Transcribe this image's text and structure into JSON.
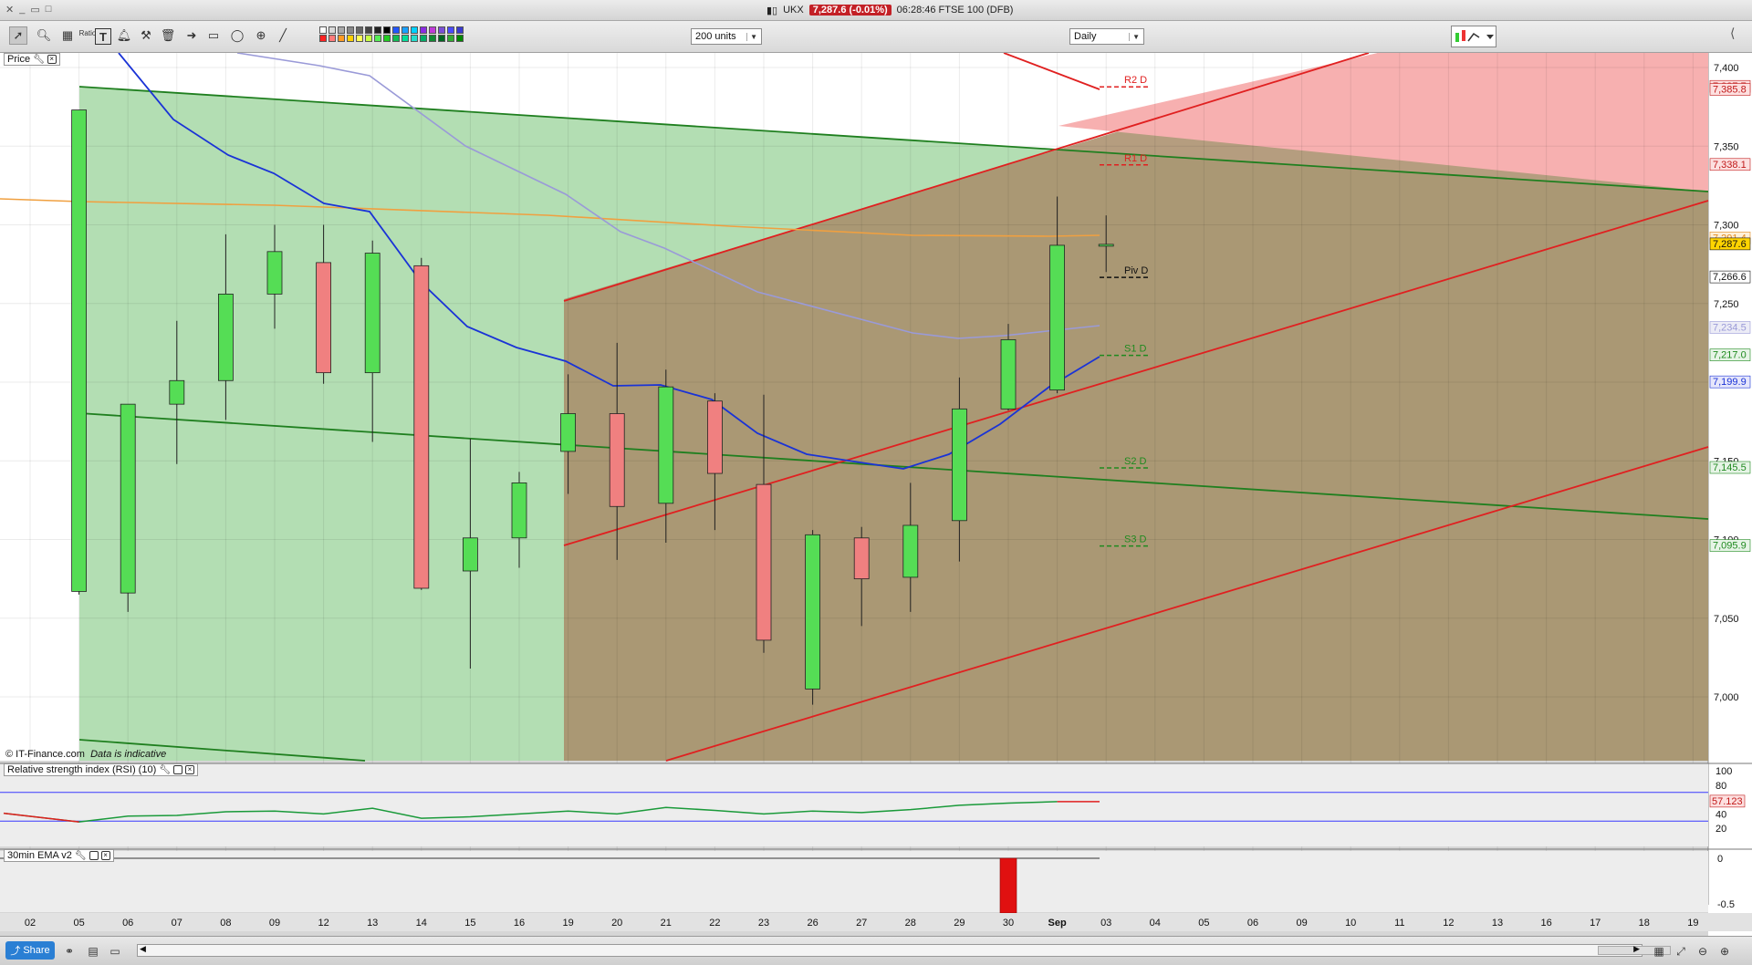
{
  "window": {
    "symbol": "UKX",
    "price_badge": "7,287.6 (-0.01%)",
    "subtitle": "06:28:46 FTSE 100 (DFB)"
  },
  "toolbar": {
    "units_select": "200 units",
    "interval_select": "Daily",
    "tools": [
      "pointer-icon",
      "zoom-icon",
      "ratio-icon",
      "text-icon",
      "alert-icon",
      "hammer-icon",
      "trash-icon",
      "arrow-icon",
      "rectangle-icon",
      "ellipse-icon",
      "crosshair-icon",
      "line-icon"
    ],
    "ratio_label": "Ratio",
    "text_tool_label": "T",
    "swatch_colors": [
      "#ffffff",
      "#d8d8d8",
      "#a8a8a8",
      "#888888",
      "#666666",
      "#444444",
      "#222222",
      "#000000",
      "#2255ff",
      "#1aa0ff",
      "#00d0ff",
      "#8a2be2",
      "#c03ad8",
      "#7a4fd6",
      "#4b4bff",
      "#3a3acf",
      "#ff2222",
      "#ff7a7a",
      "#ff9a22",
      "#ffd000",
      "#ffff55",
      "#c8ff44",
      "#55ee55",
      "#22cc22",
      "#11bb55",
      "#00dd99",
      "#22ddcc",
      "#00aa66",
      "#118833",
      "#006622",
      "#33aa33",
      "#008800"
    ]
  },
  "panels": {
    "price_label": "Price",
    "rsi_label": "Relative strength index (RSI) (10)",
    "ema_label": "30min EMA v2",
    "watermark": "© IT-Finance.com",
    "watermark_note": "Data is indicative"
  },
  "bottom": {
    "share_label": "Share"
  },
  "chart_data": {
    "type": "candlestick",
    "title": "",
    "x_labels": [
      "02",
      "05",
      "06",
      "07",
      "08",
      "09",
      "12",
      "13",
      "14",
      "15",
      "16",
      "19",
      "20",
      "21",
      "22",
      "23",
      "26",
      "27",
      "28",
      "29",
      "30",
      "Sep",
      "03",
      "04",
      "05",
      "06",
      "09",
      "10",
      "11",
      "12",
      "13",
      "16",
      "17",
      "18",
      "19"
    ],
    "y_ticks": [
      "7,400",
      "7,350",
      "7,300",
      "7,250",
      "7,200",
      "7,150",
      "7,100",
      "7,050",
      "7,000"
    ],
    "y_range": [
      6975,
      7420
    ],
    "candles": [
      {
        "x": "05",
        "o": 7067,
        "h": 7070,
        "l": 7065,
        "c": 7373
      },
      {
        "x": "06",
        "o": 7066,
        "h": 7134,
        "l": 7054,
        "c": 7186
      },
      {
        "x": "07",
        "o": 7186,
        "h": 7239,
        "l": 7148,
        "c": 7201
      },
      {
        "x": "08",
        "o": 7201,
        "h": 7294,
        "l": 7176,
        "c": 7256
      },
      {
        "x": "09",
        "o": 7256,
        "h": 7300,
        "l": 7234,
        "c": 7283
      },
      {
        "x": "12",
        "o": 7276,
        "h": 7300,
        "l": 7199,
        "c": 7206
      },
      {
        "x": "13",
        "o": 7206,
        "h": 7290,
        "l": 7162,
        "c": 7282
      },
      {
        "x": "14",
        "o": 7274,
        "h": 7279,
        "l": 7068,
        "c": 7069
      },
      {
        "x": "15",
        "o": 7080,
        "h": 7164,
        "l": 7018,
        "c": 7101
      },
      {
        "x": "16",
        "o": 7101,
        "h": 7143,
        "l": 7082,
        "c": 7136
      },
      {
        "x": "19",
        "o": 7156,
        "h": 7205,
        "l": 7129,
        "c": 7180
      },
      {
        "x": "20",
        "o": 7180,
        "h": 7225,
        "l": 7087,
        "c": 7121
      },
      {
        "x": "21",
        "o": 7123,
        "h": 7208,
        "l": 7098,
        "c": 7197
      },
      {
        "x": "22",
        "o": 7188,
        "h": 7193,
        "l": 7106,
        "c": 7142
      },
      {
        "x": "23",
        "o": 7135,
        "h": 7192,
        "l": 7028,
        "c": 7036
      },
      {
        "x": "26",
        "o": 7005,
        "h": 7106,
        "l": 6995,
        "c": 7103
      },
      {
        "x": "27",
        "o": 7101,
        "h": 7108,
        "l": 7045,
        "c": 7075
      },
      {
        "x": "28",
        "o": 7076,
        "h": 7136,
        "l": 7054,
        "c": 7109
      },
      {
        "x": "29",
        "o": 7112,
        "h": 7203,
        "l": 7086,
        "c": 7183
      },
      {
        "x": "30",
        "o": 7183,
        "h": 7237,
        "l": 7182,
        "c": 7227
      },
      {
        "x": "Sep",
        "o": 7195,
        "h": 7318,
        "l": 7193,
        "c": 7287
      },
      {
        "x": "03",
        "o": 7287,
        "h": 7306,
        "l": 7270,
        "c": 7287.6
      }
    ],
    "pivot_levels": [
      {
        "label": "R2 D",
        "value": "7,387.7",
        "color": "#e02020"
      },
      {
        "label": "R1 D",
        "value": "7,338.1",
        "color": "#e02020"
      },
      {
        "label": "Piv D",
        "value": "7,266.6",
        "color": "#111111"
      },
      {
        "label": "S1 D",
        "value": "7,217.0",
        "color": "#1f8a1f"
      },
      {
        "label": "S2 D",
        "value": "7,145.5",
        "color": "#1f8a1f"
      },
      {
        "label": "S3 D",
        "value": "7,095.9",
        "color": "#1f8a1f"
      }
    ],
    "right_tags": [
      {
        "value": "7,387.7",
        "bg": "#fde0e0",
        "fg": "#c01818"
      },
      {
        "value": "7,385.8",
        "bg": "#fde0e0",
        "fg": "#c01818"
      },
      {
        "value": "7,338.1",
        "bg": "#fde0e0",
        "fg": "#c01818"
      },
      {
        "value": "7,291.4",
        "bg": "#fff0d8",
        "fg": "#e08a20"
      },
      {
        "value": "7,287.6",
        "bg": "#ffd400",
        "fg": "#111111"
      },
      {
        "value": "7,266.6",
        "bg": "#ffffff",
        "fg": "#111111"
      },
      {
        "value": "7,234.5",
        "bg": "#ececf6",
        "fg": "#9a9ad8"
      },
      {
        "value": "7,217.0",
        "bg": "#e6f4e6",
        "fg": "#1f8a1f"
      },
      {
        "value": "7,199.9",
        "bg": "#e6e6fb",
        "fg": "#1a33d6"
      },
      {
        "value": "7,145.5",
        "bg": "#e6f4e6",
        "fg": "#1f8a1f"
      },
      {
        "value": "7,095.9",
        "bg": "#e6f4e6",
        "fg": "#1f8a1f"
      }
    ],
    "rsi": {
      "y_ticks": [
        "100",
        "80",
        "40",
        "20"
      ],
      "y_range": [
        0,
        100
      ],
      "levels": [
        30,
        70
      ],
      "last_value": "57.123",
      "values": [
        41,
        29,
        37,
        38,
        43,
        44,
        40,
        48,
        34,
        36,
        40,
        44,
        40,
        49,
        45,
        40,
        44,
        42,
        46,
        52,
        55,
        57.1,
        57.1
      ]
    },
    "ema": {
      "y_ticks": [
        "0",
        "-0.5"
      ],
      "bar_x": "30",
      "bar_value": -0.6
    },
    "colors": {
      "up": "#55dd55",
      "down": "#f08080",
      "ema_blue": "#1a33d6",
      "ema_lavender": "#9a9ad8",
      "ema_orange": "#f0a040",
      "channel_green": "#1f7f1f",
      "channel_red": "#e02020"
    }
  }
}
